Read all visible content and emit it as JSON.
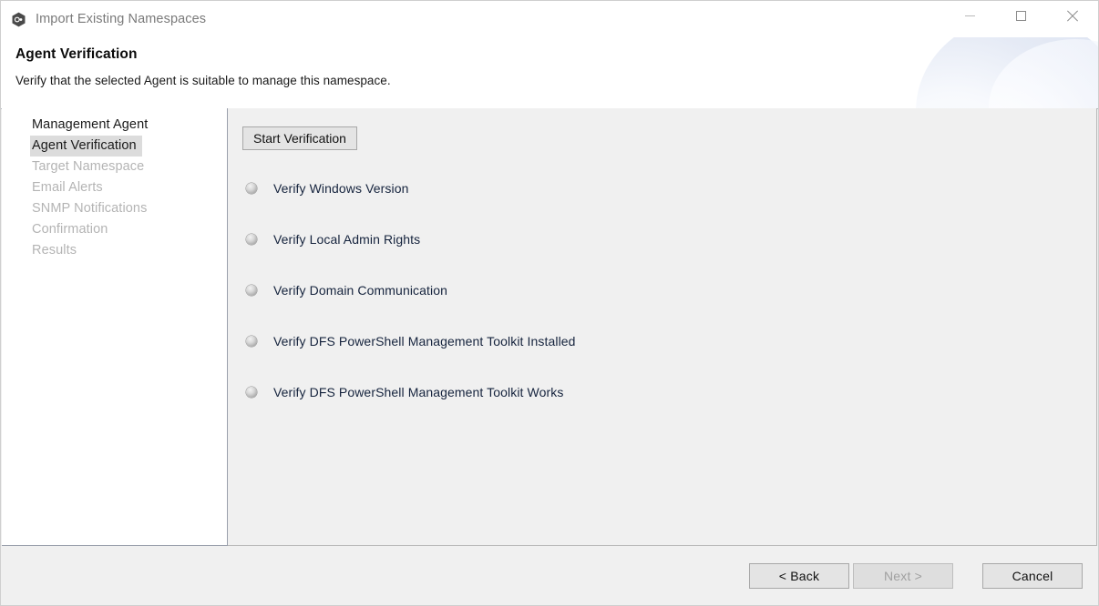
{
  "window": {
    "title": "Import Existing Namespaces",
    "app_icon": "hexagon-namespace-icon",
    "controls": {
      "minimize": "Minimize",
      "maximize": "Maximize",
      "close": "Close"
    }
  },
  "header": {
    "title": "Agent Verification",
    "subtitle": "Verify that the selected Agent is suitable to manage this namespace.",
    "accent_color": "#dbe2f1"
  },
  "sidebar": {
    "items": [
      {
        "label": "Management Agent",
        "state": "done"
      },
      {
        "label": "Agent Verification",
        "state": "active"
      },
      {
        "label": "Target Namespace",
        "state": "disabled"
      },
      {
        "label": "Email Alerts",
        "state": "disabled"
      },
      {
        "label": "SNMP Notifications",
        "state": "disabled"
      },
      {
        "label": "Confirmation",
        "state": "disabled"
      },
      {
        "label": "Results",
        "state": "disabled"
      }
    ]
  },
  "content": {
    "start_button_label": "Start Verification",
    "checks": [
      {
        "label": "Verify Windows Version",
        "status": "pending",
        "indicator": "status-led-idle"
      },
      {
        "label": "Verify Local Admin Rights",
        "status": "pending",
        "indicator": "status-led-idle"
      },
      {
        "label": "Verify Domain Communication",
        "status": "pending",
        "indicator": "status-led-idle"
      },
      {
        "label": "Verify DFS PowerShell Management Toolkit Installed",
        "status": "pending",
        "indicator": "status-led-idle"
      },
      {
        "label": "Verify DFS PowerShell Management Toolkit Works",
        "status": "pending",
        "indicator": "status-led-idle"
      }
    ]
  },
  "footer": {
    "back_label": "< Back",
    "next_label": "Next >",
    "cancel_label": "Cancel",
    "next_enabled": false
  }
}
